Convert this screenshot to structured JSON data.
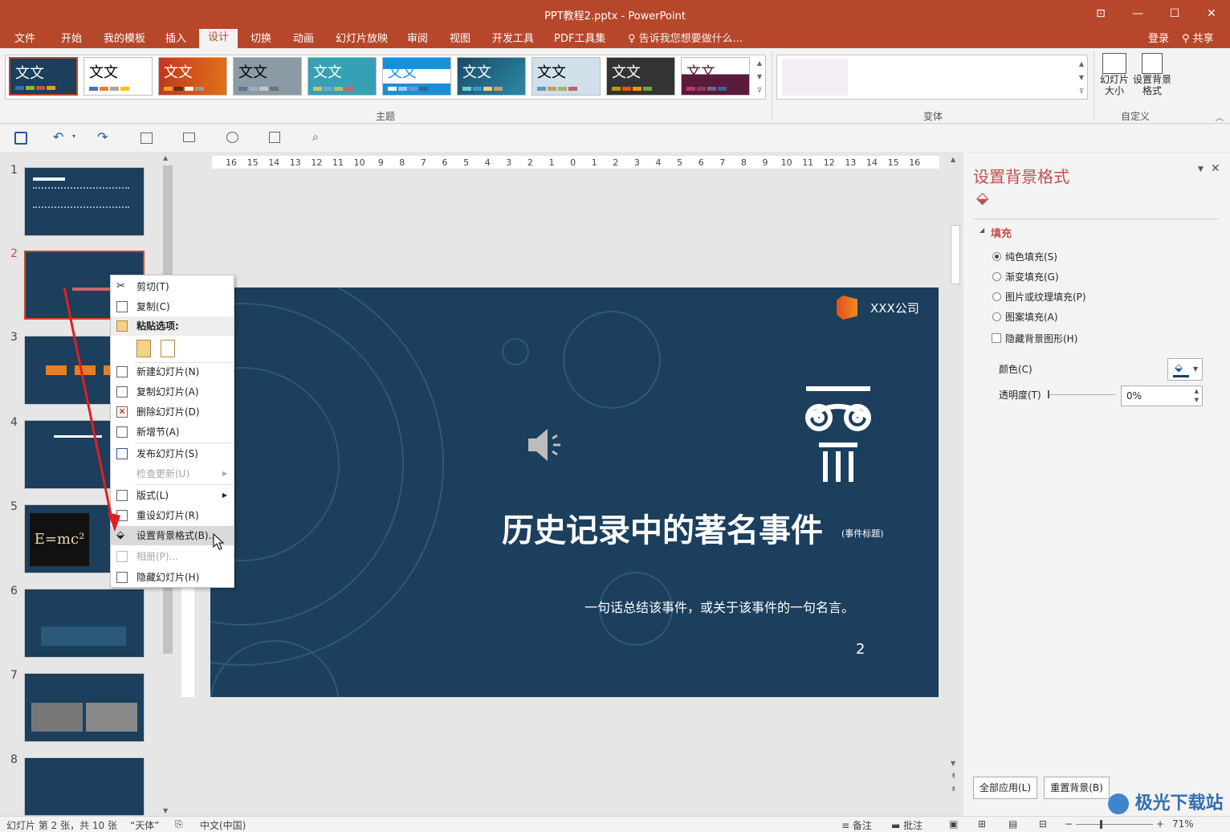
{
  "window": {
    "title": "PPT教程2.pptx - PowerPoint"
  },
  "tabs": [
    "文件",
    "开始",
    "我的模板",
    "插入",
    "设计",
    "切换",
    "动画",
    "幻灯片放映",
    "审阅",
    "视图",
    "开发工具",
    "PDF工具集"
  ],
  "active_tab": "设计",
  "tell_me": "告诉我您想要做什么...",
  "login": "登录",
  "share": "共享",
  "themes": {
    "sample_text": "文文",
    "group_label": "主题"
  },
  "variants": {
    "group_label": "变体"
  },
  "customize": {
    "slide_size": "幻灯片大小",
    "format_bg": "设置背景格式",
    "group_label": "自定义"
  },
  "ruler_labels": [
    "16",
    "15",
    "14",
    "13",
    "12",
    "11",
    "10",
    "9",
    "8",
    "7",
    "6",
    "5",
    "4",
    "3",
    "2",
    "1",
    "0",
    "1",
    "2",
    "3",
    "4",
    "5",
    "6",
    "7",
    "8",
    "9",
    "10",
    "11",
    "12",
    "13",
    "14",
    "15",
    "16"
  ],
  "slide_numbers": [
    "1",
    "2",
    "3",
    "4",
    "5",
    "6",
    "7",
    "8"
  ],
  "slide": {
    "company": "XXX公司",
    "title": "历史记录中的著名事件",
    "title_note": "(事件标题)",
    "subtitle": "一句话总结该事件，或关于该事件的一句名言。",
    "page_no": "2"
  },
  "thumb_formula": "E=mc²",
  "context_menu": {
    "cut": "剪切(T)",
    "copy": "复制(C)",
    "paste_options": "粘贴选项:",
    "new_slide": "新建幻灯片(N)",
    "dup_slide": "复制幻灯片(A)",
    "del_slide": "删除幻灯片(D)",
    "add_section": "新增节(A)",
    "publish": "发布幻灯片(S)",
    "check_update": "检查更新(U)",
    "layout": "版式(L)",
    "reset": "重设幻灯片(R)",
    "format_bg": "设置背景格式(B)...",
    "album": "相册(P)...",
    "hide": "隐藏幻灯片(H)"
  },
  "pane": {
    "title": "设置背景格式",
    "fill_header": "填充",
    "solid": "纯色填充(S)",
    "gradient": "渐变填充(G)",
    "picture": "图片或纹理填充(P)",
    "pattern": "图案填充(A)",
    "hide_graphics": "隐藏背景图形(H)",
    "color": "颜色(C)",
    "transparency": "透明度(T)",
    "transparency_value": "0%",
    "apply_all": "全部应用(L)",
    "reset_bg": "重置背景(B)"
  },
  "status": {
    "slide_info": "幻灯片 第 2 张，共 10 张",
    "theme": "“天体”",
    "language": "中文(中国)",
    "notes": "备注",
    "comments": "批注",
    "zoom": "71%"
  },
  "watermark": "极光下载站",
  "colors": {
    "accent": "#b7472a",
    "slide_bg": "#1b3f5c",
    "pane_title": "#c0504d"
  }
}
